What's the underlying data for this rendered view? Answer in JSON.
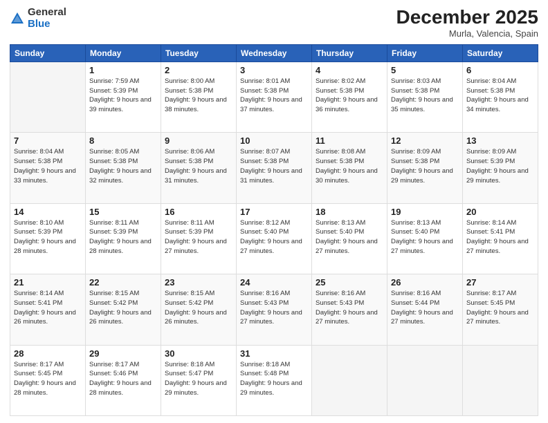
{
  "header": {
    "logo_general": "General",
    "logo_blue": "Blue",
    "month_title": "December 2025",
    "location": "Murla, Valencia, Spain"
  },
  "days_of_week": [
    "Sunday",
    "Monday",
    "Tuesday",
    "Wednesday",
    "Thursday",
    "Friday",
    "Saturday"
  ],
  "weeks": [
    [
      {
        "day": "",
        "info": ""
      },
      {
        "day": "1",
        "info": "Sunrise: 7:59 AM\nSunset: 5:39 PM\nDaylight: 9 hours\nand 39 minutes."
      },
      {
        "day": "2",
        "info": "Sunrise: 8:00 AM\nSunset: 5:38 PM\nDaylight: 9 hours\nand 38 minutes."
      },
      {
        "day": "3",
        "info": "Sunrise: 8:01 AM\nSunset: 5:38 PM\nDaylight: 9 hours\nand 37 minutes."
      },
      {
        "day": "4",
        "info": "Sunrise: 8:02 AM\nSunset: 5:38 PM\nDaylight: 9 hours\nand 36 minutes."
      },
      {
        "day": "5",
        "info": "Sunrise: 8:03 AM\nSunset: 5:38 PM\nDaylight: 9 hours\nand 35 minutes."
      },
      {
        "day": "6",
        "info": "Sunrise: 8:04 AM\nSunset: 5:38 PM\nDaylight: 9 hours\nand 34 minutes."
      }
    ],
    [
      {
        "day": "7",
        "info": "Sunrise: 8:04 AM\nSunset: 5:38 PM\nDaylight: 9 hours\nand 33 minutes."
      },
      {
        "day": "8",
        "info": "Sunrise: 8:05 AM\nSunset: 5:38 PM\nDaylight: 9 hours\nand 32 minutes."
      },
      {
        "day": "9",
        "info": "Sunrise: 8:06 AM\nSunset: 5:38 PM\nDaylight: 9 hours\nand 31 minutes."
      },
      {
        "day": "10",
        "info": "Sunrise: 8:07 AM\nSunset: 5:38 PM\nDaylight: 9 hours\nand 31 minutes."
      },
      {
        "day": "11",
        "info": "Sunrise: 8:08 AM\nSunset: 5:38 PM\nDaylight: 9 hours\nand 30 minutes."
      },
      {
        "day": "12",
        "info": "Sunrise: 8:09 AM\nSunset: 5:38 PM\nDaylight: 9 hours\nand 29 minutes."
      },
      {
        "day": "13",
        "info": "Sunrise: 8:09 AM\nSunset: 5:39 PM\nDaylight: 9 hours\nand 29 minutes."
      }
    ],
    [
      {
        "day": "14",
        "info": "Sunrise: 8:10 AM\nSunset: 5:39 PM\nDaylight: 9 hours\nand 28 minutes."
      },
      {
        "day": "15",
        "info": "Sunrise: 8:11 AM\nSunset: 5:39 PM\nDaylight: 9 hours\nand 28 minutes."
      },
      {
        "day": "16",
        "info": "Sunrise: 8:11 AM\nSunset: 5:39 PM\nDaylight: 9 hours\nand 27 minutes."
      },
      {
        "day": "17",
        "info": "Sunrise: 8:12 AM\nSunset: 5:40 PM\nDaylight: 9 hours\nand 27 minutes."
      },
      {
        "day": "18",
        "info": "Sunrise: 8:13 AM\nSunset: 5:40 PM\nDaylight: 9 hours\nand 27 minutes."
      },
      {
        "day": "19",
        "info": "Sunrise: 8:13 AM\nSunset: 5:40 PM\nDaylight: 9 hours\nand 27 minutes."
      },
      {
        "day": "20",
        "info": "Sunrise: 8:14 AM\nSunset: 5:41 PM\nDaylight: 9 hours\nand 27 minutes."
      }
    ],
    [
      {
        "day": "21",
        "info": "Sunrise: 8:14 AM\nSunset: 5:41 PM\nDaylight: 9 hours\nand 26 minutes."
      },
      {
        "day": "22",
        "info": "Sunrise: 8:15 AM\nSunset: 5:42 PM\nDaylight: 9 hours\nand 26 minutes."
      },
      {
        "day": "23",
        "info": "Sunrise: 8:15 AM\nSunset: 5:42 PM\nDaylight: 9 hours\nand 26 minutes."
      },
      {
        "day": "24",
        "info": "Sunrise: 8:16 AM\nSunset: 5:43 PM\nDaylight: 9 hours\nand 27 minutes."
      },
      {
        "day": "25",
        "info": "Sunrise: 8:16 AM\nSunset: 5:43 PM\nDaylight: 9 hours\nand 27 minutes."
      },
      {
        "day": "26",
        "info": "Sunrise: 8:16 AM\nSunset: 5:44 PM\nDaylight: 9 hours\nand 27 minutes."
      },
      {
        "day": "27",
        "info": "Sunrise: 8:17 AM\nSunset: 5:45 PM\nDaylight: 9 hours\nand 27 minutes."
      }
    ],
    [
      {
        "day": "28",
        "info": "Sunrise: 8:17 AM\nSunset: 5:45 PM\nDaylight: 9 hours\nand 28 minutes."
      },
      {
        "day": "29",
        "info": "Sunrise: 8:17 AM\nSunset: 5:46 PM\nDaylight: 9 hours\nand 28 minutes."
      },
      {
        "day": "30",
        "info": "Sunrise: 8:18 AM\nSunset: 5:47 PM\nDaylight: 9 hours\nand 29 minutes."
      },
      {
        "day": "31",
        "info": "Sunrise: 8:18 AM\nSunset: 5:48 PM\nDaylight: 9 hours\nand 29 minutes."
      },
      {
        "day": "",
        "info": ""
      },
      {
        "day": "",
        "info": ""
      },
      {
        "day": "",
        "info": ""
      }
    ]
  ]
}
